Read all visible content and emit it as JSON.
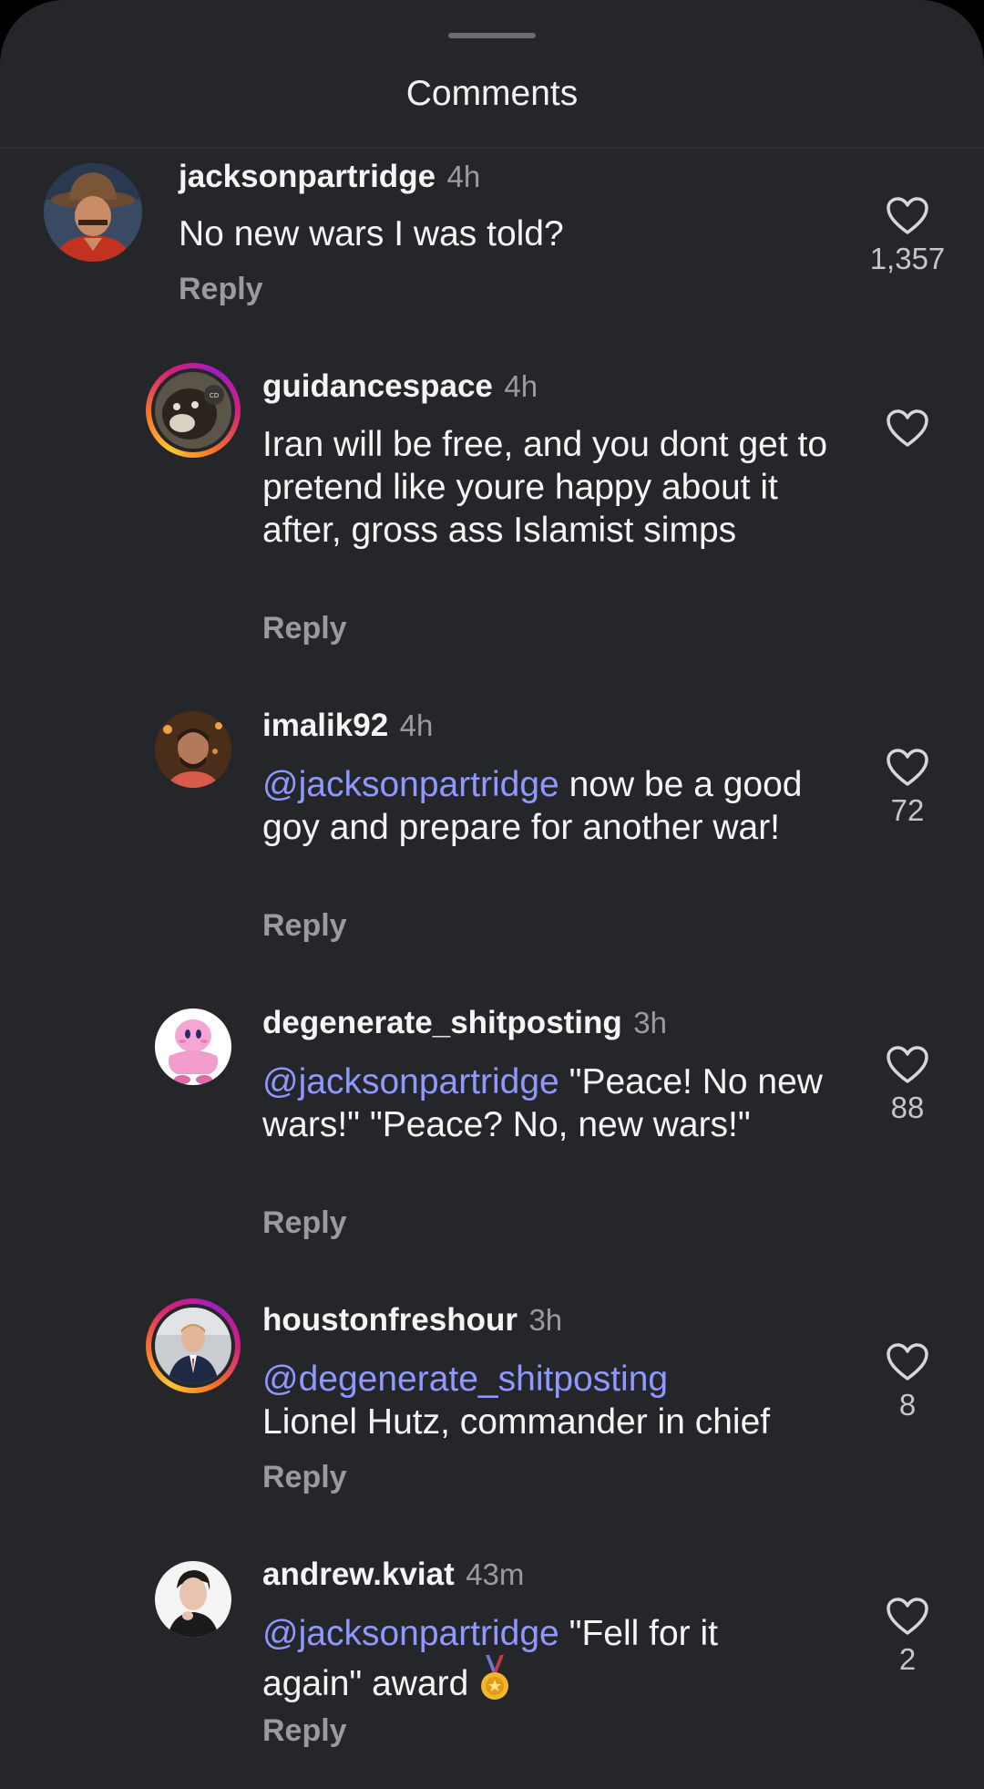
{
  "sheet": {
    "title": "Comments"
  },
  "comments": [
    {
      "username": "jacksonpartridge",
      "time": "4h",
      "mention": "",
      "text": "No new wars I was told?",
      "reply": "Reply",
      "likes": "1,357",
      "story_ring": false
    },
    {
      "username": "guidancespace",
      "time": "4h",
      "mention": "",
      "text": "Iran will be free, and you dont get to pretend like youre happy about it after, gross ass Islamist simps",
      "reply": "Reply",
      "likes": "",
      "story_ring": true
    },
    {
      "username": "imalik92",
      "time": "4h",
      "mention": "@jacksonpartridge",
      "text": "now be a good goy and prepare for another war!",
      "reply": "Reply",
      "likes": "72",
      "story_ring": false
    },
    {
      "username": "degenerate_shitposting",
      "time": "3h",
      "mention": "@jacksonpartridge",
      "text": "\"Peace! No new wars!\" \"Peace? No, new wars!\"",
      "reply": "Reply",
      "likes": "88",
      "story_ring": false
    },
    {
      "username": "houstonfreshour",
      "time": "3h",
      "mention": "@degenerate_shitposting",
      "text": "Lionel Hutz, commander in chief",
      "reply": "Reply",
      "likes": "8",
      "story_ring": true
    },
    {
      "username": "andrew.kviat",
      "time": "43m",
      "mention": "@jacksonpartridge",
      "text": "\"Fell for it again\" award",
      "reply": "Reply",
      "likes": "2",
      "story_ring": false,
      "emoji": "medal-icon"
    }
  ],
  "colors": {
    "background": "#25262a",
    "mention": "#8e98ff",
    "secondary_text": "#9a9ba0",
    "primary_text": "#f5f5f5"
  }
}
